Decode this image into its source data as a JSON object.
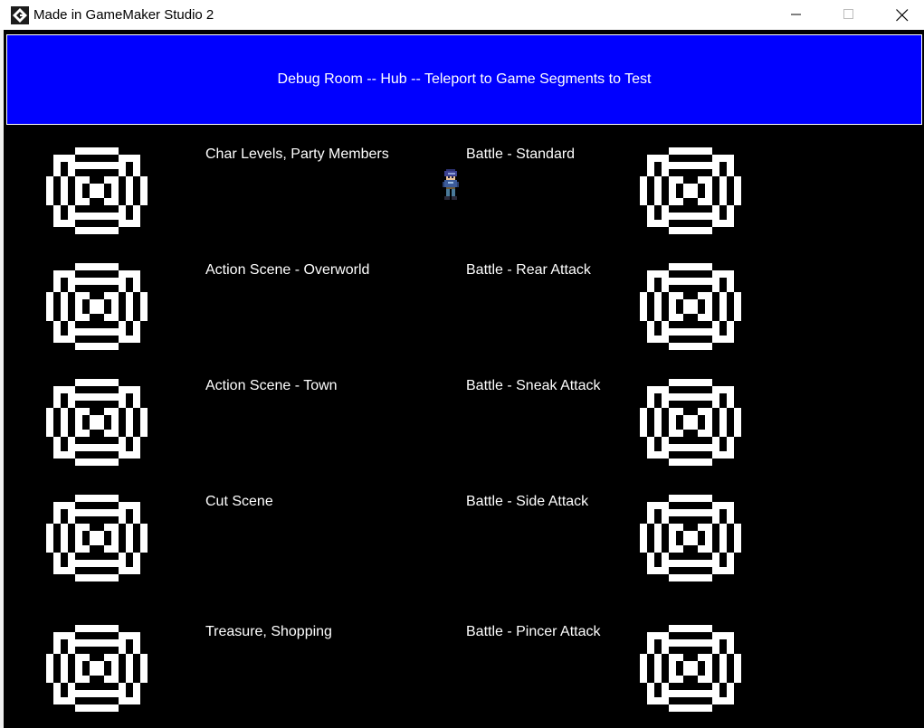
{
  "window": {
    "title": "Made in GameMaker Studio 2",
    "icon": "gamemaker-icon",
    "controls": [
      "minimize-icon",
      "maximize-icon",
      "close-icon"
    ]
  },
  "game": {
    "background": "#000000",
    "header": {
      "text": "Debug Room -- Hub -- Teleport to Game Segments to Test",
      "background": "#0000ff",
      "text_color": "#ffffff"
    },
    "left_labels": [
      "Char Levels, Party Members",
      "Action Scene - Overworld",
      "Action Scene - Town",
      "Cut Scene",
      "Treasure, Shopping"
    ],
    "right_labels": [
      "Battle - Standard",
      "Battle - Rear Attack",
      "Battle - Sneak Attack",
      "Battle - Side Attack",
      "Battle - Pincer Attack"
    ],
    "teleporter_icon": "teleporter-pad-icon",
    "player_icon": "player-character-icon"
  }
}
